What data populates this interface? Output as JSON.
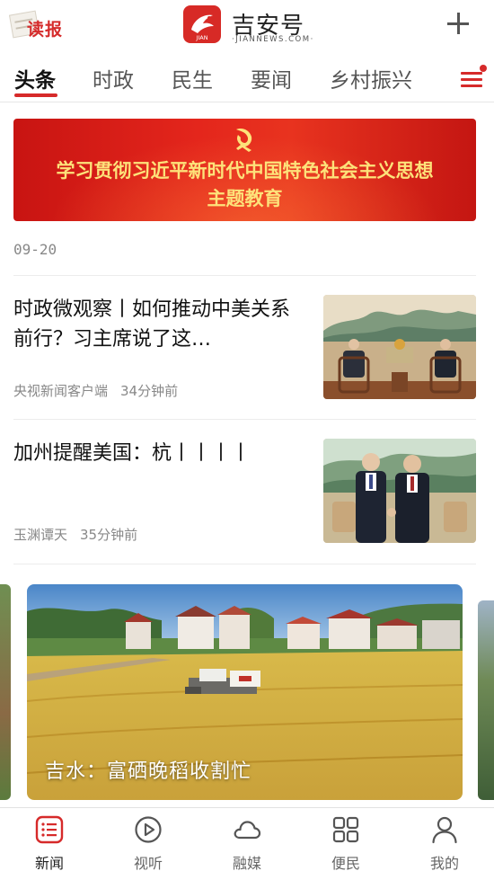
{
  "header": {
    "reader_label": "读报",
    "logo_title": "吉安号",
    "logo_subtitle": "·JIANNEWS.COM·",
    "logo_mark_text": "JIAN"
  },
  "tabs": [
    {
      "label": "头条",
      "active": true
    },
    {
      "label": "时政",
      "active": false
    },
    {
      "label": "民生",
      "active": false
    },
    {
      "label": "要闻",
      "active": false
    },
    {
      "label": "乡村振兴",
      "active": false
    }
  ],
  "banner": {
    "line1": "学习贯彻习近平新时代中国特色社会主义思想",
    "line2": "主题教育"
  },
  "date_label": "09-20",
  "news": [
    {
      "title": "时政微观察丨如何推动中美关系前行？习主席说了这…",
      "source": "央视新闻客户端",
      "time": "34分钟前"
    },
    {
      "title": "加州提醒美国：杭丨丨丨丨",
      "source": "玉渊谭天",
      "time": "35分钟前"
    }
  ],
  "carousel": {
    "caption": "吉水：富硒晚稻收割忙"
  },
  "bottom_nav": [
    {
      "label": "新闻",
      "icon": "news-list-icon",
      "active": true
    },
    {
      "label": "视听",
      "icon": "play-icon",
      "active": false
    },
    {
      "label": "融媒",
      "icon": "cloud-icon",
      "active": false
    },
    {
      "label": "便民",
      "icon": "grid-icon",
      "active": false
    },
    {
      "label": "我的",
      "icon": "user-icon",
      "active": false
    }
  ],
  "colors": {
    "brand_red": "#d62a2a",
    "banner_text": "#fde27a"
  }
}
